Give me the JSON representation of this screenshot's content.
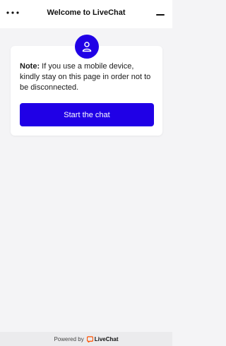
{
  "header": {
    "title": "Welcome to LiveChat",
    "menu_icon": "more-horizontal-icon",
    "minimize_icon": "minimize-icon"
  },
  "card": {
    "avatar_icon": "user-icon",
    "note_label": "Note:",
    "note_text": " If you use a mobile device, kindly stay on this page in order not to be disconnected.",
    "start_button_label": "Start the chat"
  },
  "footer": {
    "powered_by": "Powered by",
    "brand_name": "LiveChat",
    "brand_icon": "livechat-logo-icon"
  },
  "colors": {
    "accent": "#2000e6",
    "brand_orange": "#ff5100",
    "background": "#f4f4f6"
  }
}
